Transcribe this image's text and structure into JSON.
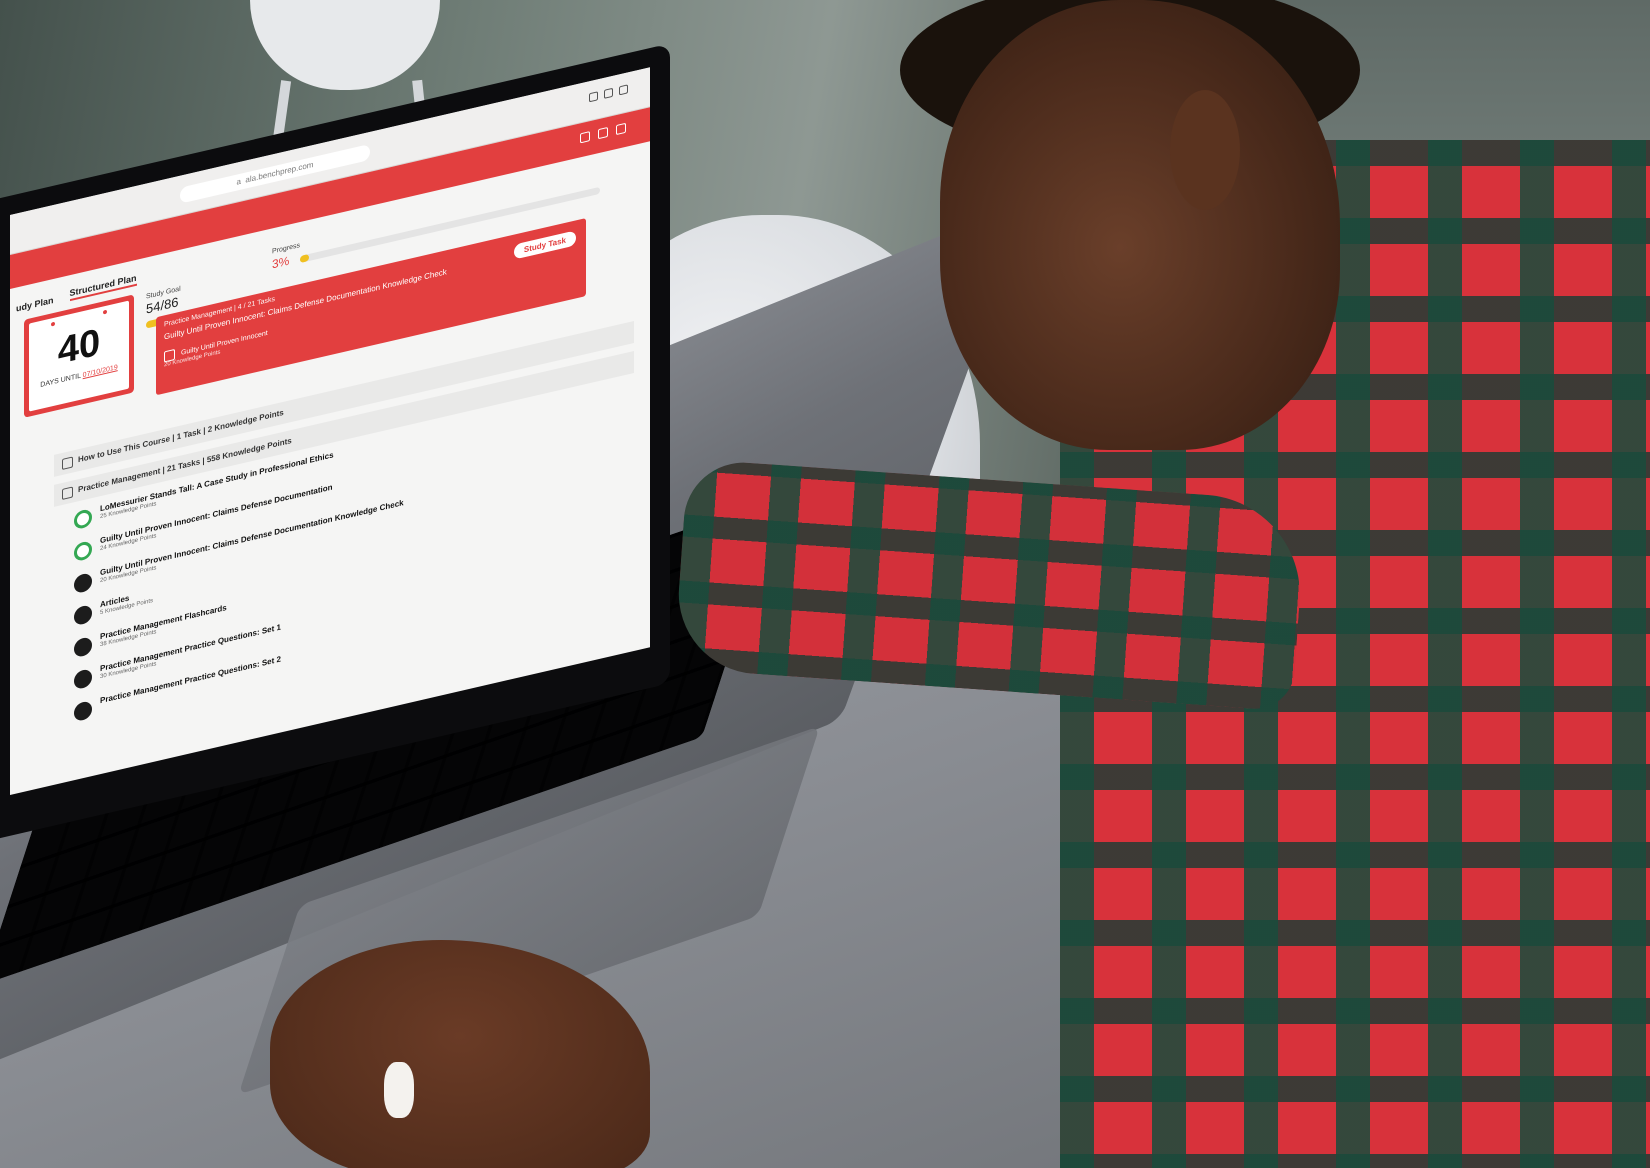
{
  "browser": {
    "url": "a  ala.benchprep.com"
  },
  "app": {
    "accent_color": "#e23f3f",
    "tabs": [
      "udy Plan",
      "Structured Plan"
    ],
    "countdown": {
      "days": "40",
      "label_prefix": "DAYS UNTIL",
      "date": "07/10/2019"
    },
    "study_goal": {
      "label": "Study Goal",
      "value": "54/86",
      "fraction": 0.63
    },
    "progress": {
      "label": "Progress",
      "value": "3%",
      "fraction": 0.03
    },
    "current_task": {
      "module": "Practice Management | 4 / 21 Tasks",
      "title": "Guilty Until Proven Innocent: Claims Defense Documentation Knowledge Check",
      "task_title": "Guilty Until Proven Innocent",
      "task_points": "20 Knowledge Points",
      "button_label": "Study Task"
    },
    "sections": [
      {
        "label": "How to Use This Course | 1 Task | 2 Knowledge Points"
      },
      {
        "label": "Practice Management | 21 Tasks | 558 Knowledge Points"
      }
    ],
    "items": [
      {
        "title": "LoMessurier Stands Tall: A Case Study in Professional Ethics",
        "points": "25 Knowledge Points",
        "status": "green"
      },
      {
        "title": "Guilty Until Proven Innocent: Claims Defense Documentation",
        "points": "24 Knowledge Points",
        "status": "green"
      },
      {
        "title": "Guilty Until Proven Innocent: Claims Defense Documentation Knowledge Check",
        "points": "20 Knowledge Points",
        "status": "dark"
      },
      {
        "title": "Articles",
        "points": "5 Knowledge Points",
        "status": "dark"
      },
      {
        "title": "Practice Management Flashcards",
        "points": "38 Knowledge Points",
        "status": "dark"
      },
      {
        "title": "Practice Management Practice Questions: Set 1",
        "points": "30 Knowledge Points",
        "status": "dark"
      },
      {
        "title": "Practice Management Practice Questions: Set 2",
        "points": "",
        "status": "dark"
      }
    ]
  }
}
